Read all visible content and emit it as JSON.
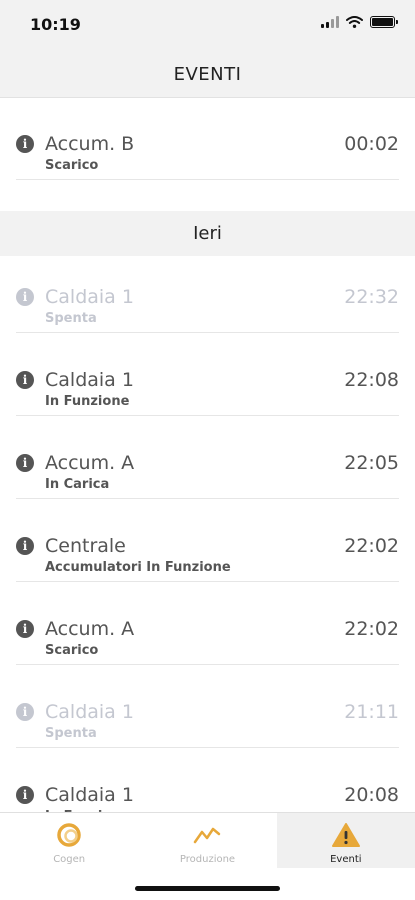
{
  "status_bar": {
    "time": "10:19"
  },
  "nav": {
    "title": "EVENTI"
  },
  "events_today": [
    {
      "name": "Accum. B",
      "state": "Scarico",
      "time": "00:02",
      "dimmed": false
    }
  ],
  "section_yesterday": {
    "title": "Ieri"
  },
  "events_yesterday": [
    {
      "name": "Caldaia 1",
      "state": "Spenta",
      "time": "22:32",
      "dimmed": true
    },
    {
      "name": "Caldaia 1",
      "state": "In Funzione",
      "time": "22:08",
      "dimmed": false
    },
    {
      "name": "Accum. A",
      "state": "In Carica",
      "time": "22:05",
      "dimmed": false
    },
    {
      "name": "Centrale",
      "state": "Accumulatori In Funzione",
      "time": "22:02",
      "dimmed": false
    },
    {
      "name": "Accum. A",
      "state": "Scarico",
      "time": "22:02",
      "dimmed": false
    },
    {
      "name": "Caldaia 1",
      "state": "Spenta",
      "time": "21:11",
      "dimmed": true
    },
    {
      "name": "Caldaia 1",
      "state": "In Funzione",
      "time": "20:08",
      "dimmed": false
    }
  ],
  "tabs": [
    {
      "label": "Cogen",
      "icon": "cogen-ring-icon",
      "active": false
    },
    {
      "label": "Produzione",
      "icon": "trend-line-icon",
      "active": false
    },
    {
      "label": "Eventi",
      "icon": "warning-triangle-icon",
      "active": true
    }
  ],
  "colors": {
    "accent": "#e7a83a",
    "dimmed_text": "#c4c7d0",
    "text": "#555555"
  }
}
